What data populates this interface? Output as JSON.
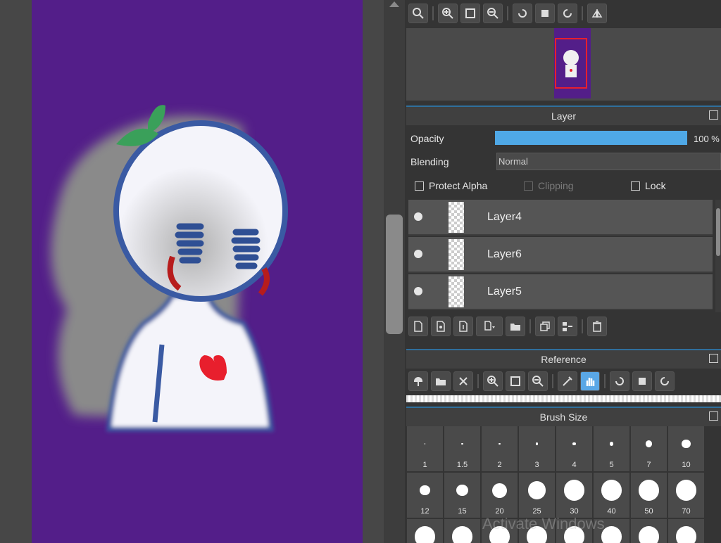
{
  "navigator_toolbar": {
    "buttons": [
      "zoom-actual-icon",
      "zoom-in-icon",
      "fit-screen-icon",
      "zoom-out-icon",
      "rotate-left-icon",
      "fullscreen-icon",
      "rotate-right-icon",
      "flip-icon"
    ]
  },
  "layer_panel": {
    "title": "Layer",
    "opacity_label": "Opacity",
    "opacity_value": "100 %",
    "opacity_fraction": 1.0,
    "blending_label": "Blending",
    "blending_value": "Normal",
    "protect_alpha_label": "Protect Alpha",
    "clipping_label": "Clipping",
    "lock_label": "Lock",
    "layers": [
      {
        "name": "Layer4"
      },
      {
        "name": "Layer6"
      },
      {
        "name": "Layer5"
      }
    ],
    "toolbar": [
      "new-layer-icon",
      "new-layer-8bit-icon",
      "new-layer-1bit-icon",
      "add-layer-menu-icon",
      "new-folder-icon",
      "duplicate-layer-icon",
      "merge-layer-icon",
      "delete-layer-icon"
    ]
  },
  "reference_panel": {
    "title": "Reference",
    "toolbar": [
      "load-canvas-icon",
      "open-file-icon",
      "clear-icon",
      "zoom-in-icon",
      "fit-screen-icon",
      "zoom-out-icon",
      "eyedropper-icon",
      "hand-icon",
      "rotate-left-icon",
      "fullscreen-icon",
      "rotate-right-icon"
    ]
  },
  "brush_panel": {
    "title": "Brush Size",
    "sizes": [
      "1",
      "1.5",
      "2",
      "3",
      "4",
      "5",
      "7",
      "10",
      "12",
      "15",
      "20",
      "25",
      "30",
      "40",
      "50",
      "70",
      "",
      "",
      "",
      "",
      "",
      "",
      "",
      ""
    ]
  },
  "watermark": "Activate Windows",
  "colors": {
    "canvas_bg": "#531e89",
    "accent": "#4fa8e6",
    "panel_bg": "#343434"
  }
}
